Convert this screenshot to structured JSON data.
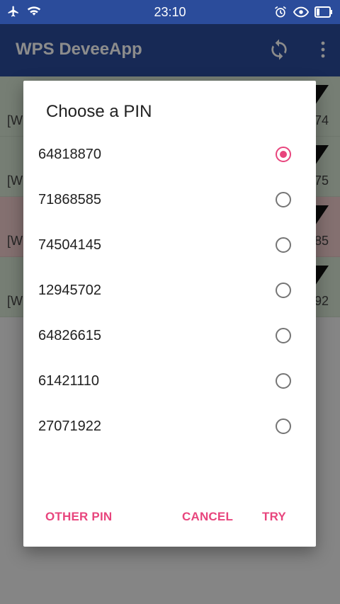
{
  "status_bar": {
    "time": "23:10"
  },
  "app": {
    "title": "WPS DeveeApp"
  },
  "background_list": [
    {
      "left_text": "[W",
      "right_text": "74",
      "color": "#d7e6d3"
    },
    {
      "left_text": "[W",
      "right_text": "75",
      "color": "#d7e6d3"
    },
    {
      "left_text": "[W",
      "right_text": "85",
      "color": "#f0cdcd"
    },
    {
      "left_text": "[W",
      "right_text": "92",
      "color": "#d7e6d3"
    }
  ],
  "dialog": {
    "title": "Choose a PIN",
    "options": [
      {
        "pin": "64818870",
        "selected": true
      },
      {
        "pin": "71868585",
        "selected": false
      },
      {
        "pin": "74504145",
        "selected": false
      },
      {
        "pin": "12945702",
        "selected": false
      },
      {
        "pin": "64826615",
        "selected": false
      },
      {
        "pin": "61421110",
        "selected": false
      },
      {
        "pin": "27071922",
        "selected": false
      }
    ],
    "buttons": {
      "other_pin": "OTHER PIN",
      "cancel": "CANCEL",
      "try": "TRY"
    }
  },
  "colors": {
    "accent": "#e8457d",
    "primary": "#2b4c9b"
  }
}
